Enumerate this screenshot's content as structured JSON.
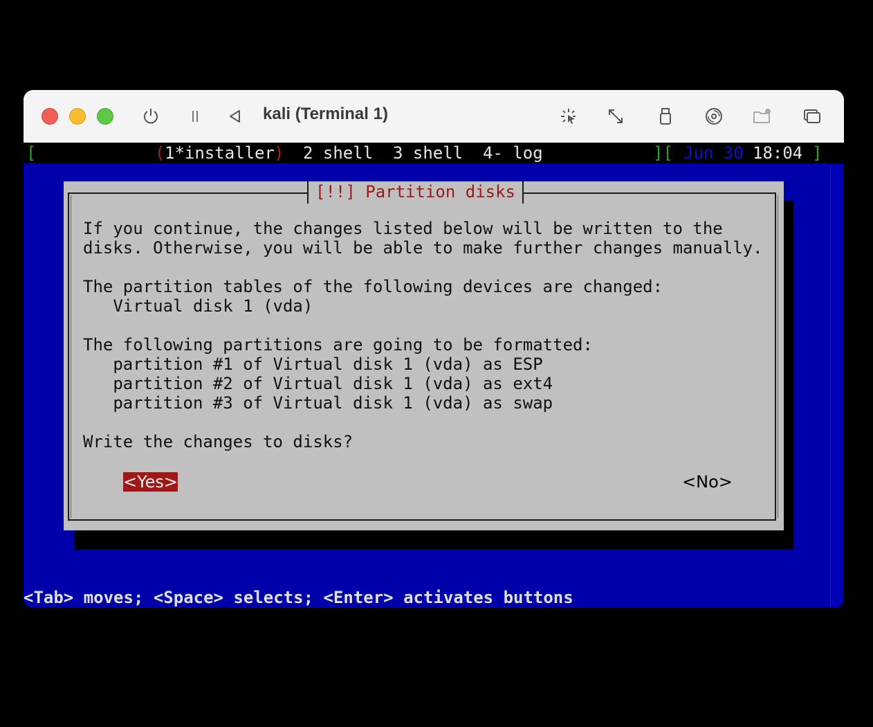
{
  "window": {
    "title": "kali (Terminal 1)",
    "toolbar_icons": [
      "power-icon",
      "pause-icon",
      "back-icon",
      "capture-mouse-icon",
      "resize-icon",
      "usb-icon",
      "disc-icon",
      "shared-folder-icon",
      "windows-icon"
    ]
  },
  "status_bar": {
    "bracket_open": "[",
    "window1_open": "(",
    "window1": "1*installer",
    "window1_close": ")",
    "window2": "2 shell",
    "window3": "3 shell",
    "window4": "4- log",
    "bracket_mid": "][",
    "date": "Jun 30",
    "time": "18:04",
    "bracket_close": "]"
  },
  "dialog": {
    "title": "[!!] Partition disks",
    "lines": [
      "If you continue, the changes listed below will be written to the",
      "disks. Otherwise, you will be able to make further changes manually.",
      "",
      "The partition tables of the following devices are changed:",
      "   Virtual disk 1 (vda)",
      "",
      "The following partitions are going to be formatted:",
      "   partition #1 of Virtual disk 1 (vda) as ESP",
      "   partition #2 of Virtual disk 1 (vda) as ext4",
      "   partition #3 of Virtual disk 1 (vda) as swap",
      "",
      "Write the changes to disks?"
    ],
    "yes_label": "<Yes>",
    "no_label": "<No>"
  },
  "help_line": "<Tab> moves; <Space> selects; <Enter> activates buttons",
  "colors": {
    "terminal_bg": "#0000aa",
    "dialog_bg": "#c0c0c0",
    "title_color": "#9a1a1a",
    "selected_button_bg": "#a01818"
  }
}
